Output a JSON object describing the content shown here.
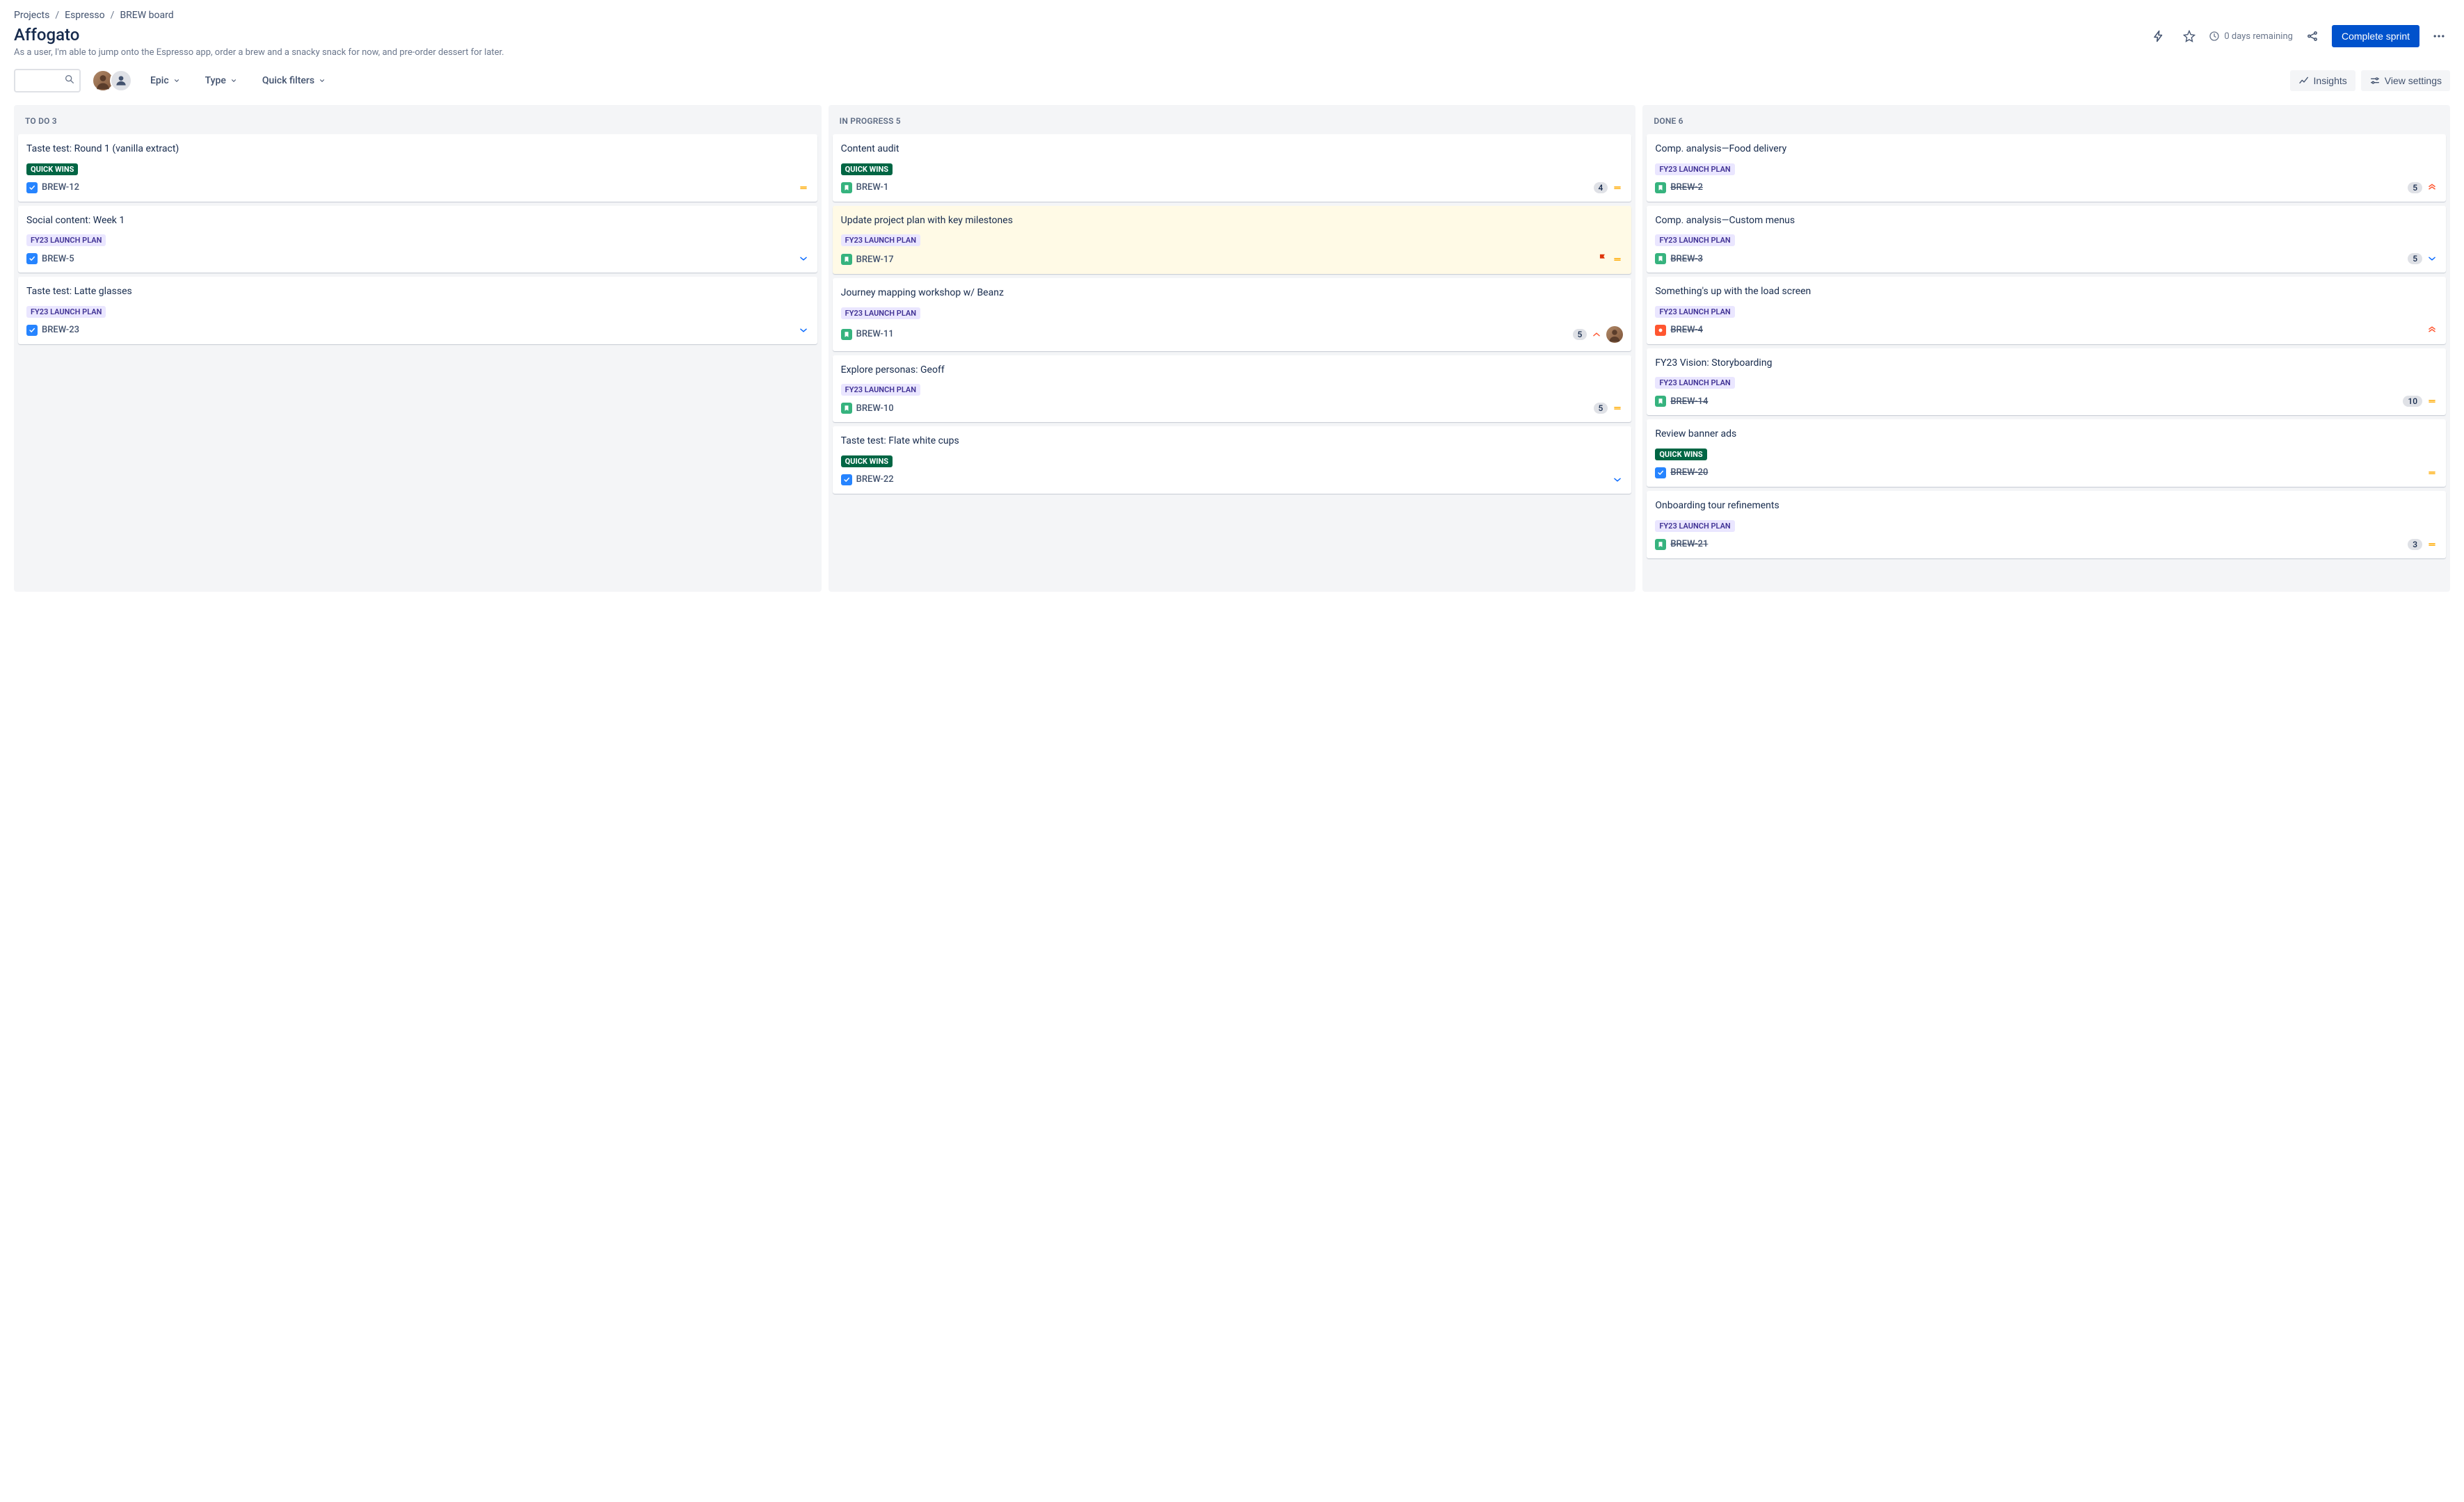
{
  "breadcrumb": {
    "projects": "Projects",
    "project": "Espresso",
    "board": "BREW board"
  },
  "sprint": {
    "name": "Affogato",
    "goal": "As a user, I'm able to jump onto the Espresso app, order a brew and a snacky snack for now, and pre-order dessert for later.",
    "remaining": "0 days remaining",
    "complete_label": "Complete sprint"
  },
  "toolbar": {
    "search_placeholder": "",
    "epic": "Epic",
    "type": "Type",
    "quick_filters": "Quick filters",
    "insights": "Insights",
    "view_settings": "View settings"
  },
  "labels": {
    "quick_wins": "QUICK WINS",
    "launch_plan": "FY23 LAUNCH PLAN"
  },
  "columns": [
    {
      "name": "TO DO",
      "count": 3,
      "cards": [
        {
          "title": "Taste test: Round 1 (vanilla extract)",
          "label": "quick_wins",
          "type": "task",
          "key": "BREW-12",
          "done": false,
          "priority": "medium"
        },
        {
          "title": "Social content: Week 1",
          "label": "launch_plan",
          "type": "task",
          "key": "BREW-5",
          "done": false,
          "priority": "low"
        },
        {
          "title": "Taste test: Latte glasses",
          "label": "launch_plan",
          "type": "task",
          "key": "BREW-23",
          "done": false,
          "priority": "low"
        }
      ]
    },
    {
      "name": "IN PROGRESS",
      "count": 5,
      "cards": [
        {
          "title": "Content audit",
          "label": "quick_wins",
          "type": "story",
          "key": "BREW-1",
          "done": false,
          "estimate": "4",
          "priority": "medium"
        },
        {
          "title": "Update project plan with key milestones",
          "label": "launch_plan",
          "type": "story",
          "key": "BREW-17",
          "done": false,
          "flagged": true,
          "priority": "medium"
        },
        {
          "title": "Journey mapping workshop w/ Beanz",
          "label": "launch_plan",
          "type": "story",
          "key": "BREW-11",
          "done": false,
          "estimate": "5",
          "priority": "high",
          "assignee": true
        },
        {
          "title": "Explore personas: Geoff",
          "label": "launch_plan",
          "type": "story",
          "key": "BREW-10",
          "done": false,
          "estimate": "5",
          "priority": "medium"
        },
        {
          "title": "Taste test: Flate white cups",
          "label": "quick_wins",
          "type": "task",
          "key": "BREW-22",
          "done": false,
          "priority": "low"
        }
      ]
    },
    {
      "name": "DONE",
      "count": 6,
      "cards": [
        {
          "title": "Comp. analysis—Food delivery",
          "label": "launch_plan",
          "type": "story",
          "key": "BREW-2",
          "done": true,
          "estimate": "5",
          "priority": "highest"
        },
        {
          "title": "Comp. analysis—Custom menus",
          "label": "launch_plan",
          "type": "story",
          "key": "BREW-3",
          "done": true,
          "estimate": "5",
          "priority": "low"
        },
        {
          "title": "Something's up with the load screen",
          "label": "launch_plan",
          "type": "bug",
          "key": "BREW-4",
          "done": true,
          "priority": "highest"
        },
        {
          "title": "FY23 Vision: Storyboarding",
          "label": "launch_plan",
          "type": "story",
          "key": "BREW-14",
          "done": true,
          "estimate": "10",
          "priority": "medium"
        },
        {
          "title": "Review banner ads",
          "label": "quick_wins",
          "type": "task",
          "key": "BREW-20",
          "done": true,
          "priority": "medium"
        },
        {
          "title": "Onboarding tour refinements",
          "label": "launch_plan",
          "type": "story",
          "key": "BREW-21",
          "done": true,
          "estimate": "3",
          "priority": "medium"
        }
      ]
    }
  ]
}
